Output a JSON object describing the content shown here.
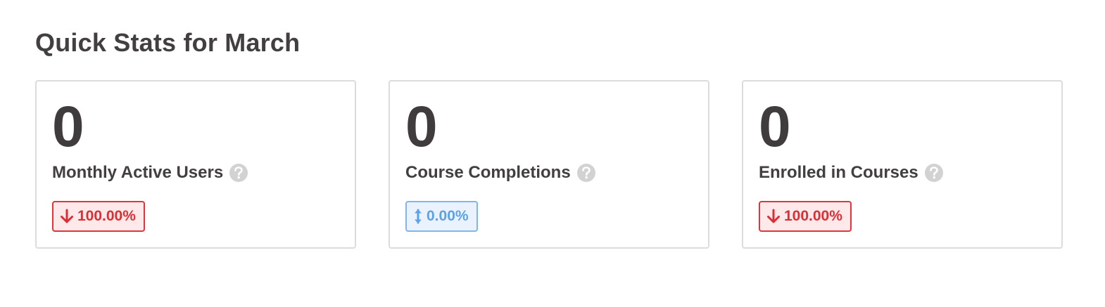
{
  "header": {
    "title": "Quick Stats for March"
  },
  "cards": [
    {
      "value": "0",
      "label": "Monthly Active Users",
      "help_icon": "question-circle-icon",
      "change": "100.00%",
      "trend": "down",
      "trend_icon": "arrow-down-icon",
      "trend_color": "#dc2f35"
    },
    {
      "value": "0",
      "label": "Course Completions",
      "help_icon": "question-circle-icon",
      "change": "0.00%",
      "trend": "neutral",
      "trend_icon": "arrows-vertical-icon",
      "trend_color": "#5aa2ea"
    },
    {
      "value": "0",
      "label": "Enrolled in Courses",
      "help_icon": "question-circle-icon",
      "change": "100.00%",
      "trend": "down",
      "trend_icon": "arrow-down-icon",
      "trend_color": "#dc2f35"
    }
  ]
}
